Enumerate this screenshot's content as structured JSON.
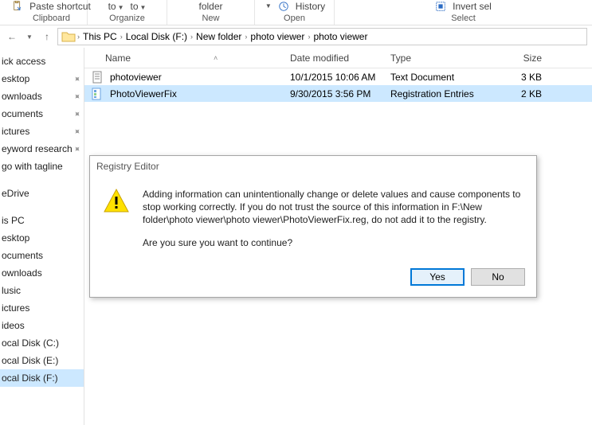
{
  "ribbon": {
    "paste_shortcut": "Paste shortcut",
    "clipboard_label": "Clipboard",
    "to1": "to",
    "to2": "to",
    "organize_label": "Organize",
    "folder": "folder",
    "new_label": "New",
    "open_label": "Open",
    "history": "History",
    "invert": "Invert sel",
    "select_label": "Select"
  },
  "breadcrumb": [
    "This PC",
    "Local Disk (F:)",
    "New folder",
    "photo viewer",
    "photo viewer"
  ],
  "columns": {
    "name": "Name",
    "date": "Date modified",
    "type": "Type",
    "size": "Size"
  },
  "files": [
    {
      "name": "photoviewer",
      "date": "10/1/2015 10:06 AM",
      "type": "Text Document",
      "size": "3 KB",
      "icon": "text"
    },
    {
      "name": "PhotoViewerFix",
      "date": "9/30/2015 3:56 PM",
      "type": "Registration Entries",
      "size": "2 KB",
      "icon": "reg"
    }
  ],
  "sidebar": [
    {
      "label": "ick access",
      "pin": false
    },
    {
      "label": "esktop",
      "pin": true
    },
    {
      "label": "ownloads",
      "pin": true
    },
    {
      "label": "ocuments",
      "pin": true
    },
    {
      "label": "ictures",
      "pin": true
    },
    {
      "label": "eyword research",
      "pin": true
    },
    {
      "label": "go with tagline",
      "pin": false
    },
    {
      "label": "",
      "pin": false,
      "spacer": true
    },
    {
      "label": "eDrive",
      "pin": false
    },
    {
      "label": "",
      "pin": false,
      "spacer": true
    },
    {
      "label": "is PC",
      "pin": false
    },
    {
      "label": "esktop",
      "pin": false
    },
    {
      "label": "ocuments",
      "pin": false
    },
    {
      "label": "ownloads",
      "pin": false
    },
    {
      "label": "lusic",
      "pin": false
    },
    {
      "label": "ictures",
      "pin": false
    },
    {
      "label": "ideos",
      "pin": false
    },
    {
      "label": "ocal Disk (C:)",
      "pin": false
    },
    {
      "label": "ocal Disk (E:)",
      "pin": false
    },
    {
      "label": "ocal Disk (F:)",
      "pin": false,
      "sel": true
    }
  ],
  "dialog": {
    "title": "Registry Editor",
    "message": "Adding information can unintentionally change or delete values and cause components to stop working correctly. If you do not trust the source of this information in F:\\New folder\\photo viewer\\photo viewer\\PhotoViewerFix.reg, do not add it to the registry.",
    "prompt": "Are you sure you want to continue?",
    "yes": "Yes",
    "no": "No"
  }
}
